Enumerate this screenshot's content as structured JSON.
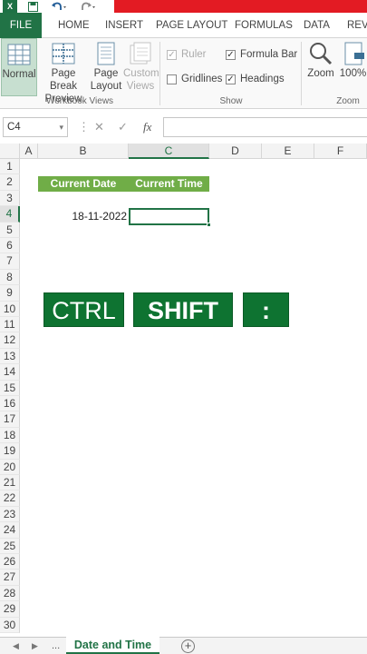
{
  "titlebar": {
    "app_icon": "excel-logo",
    "app_letter": "X",
    "quick_access": [
      "save-icon",
      "undo-icon",
      "redo-icon"
    ]
  },
  "ribbon_tabs": [
    "FILE",
    "HOME",
    "INSERT",
    "PAGE LAYOUT",
    "FORMULAS",
    "DATA",
    "REVI"
  ],
  "ribbon": {
    "workbook_views": {
      "group_label": "Workbook Views",
      "buttons": [
        {
          "label": "Normal",
          "label2": "",
          "active": true,
          "disabled": false,
          "icon": "normal-view-icon"
        },
        {
          "label": "Page Break",
          "label2": "Preview",
          "active": false,
          "disabled": false,
          "icon": "page-break-preview-icon"
        },
        {
          "label": "Page",
          "label2": "Layout",
          "active": false,
          "disabled": false,
          "icon": "page-layout-icon"
        },
        {
          "label": "Custom",
          "label2": "Views",
          "active": false,
          "disabled": true,
          "icon": "custom-views-icon"
        }
      ]
    },
    "show": {
      "group_label": "Show",
      "checkboxes": [
        {
          "label": "Ruler",
          "checked": true,
          "disabled": true
        },
        {
          "label": "Formula Bar",
          "checked": true,
          "disabled": false
        },
        {
          "label": "Gridlines",
          "checked": false,
          "disabled": false
        },
        {
          "label": "Headings",
          "checked": true,
          "disabled": false
        }
      ]
    },
    "zoom": {
      "group_label": "Zoom",
      "buttons": [
        {
          "label": "Zoom",
          "icon": "magnifier-icon"
        },
        {
          "label": "100%",
          "icon": "zoom-100-icon"
        }
      ]
    }
  },
  "formula_bar": {
    "name_box": "C4",
    "name_box_caret": "▾",
    "more": "⋮",
    "cancel": "✕",
    "enter": "✓",
    "fx": "fx",
    "formula": ""
  },
  "grid": {
    "columns": [
      "A",
      "B",
      "C",
      "D",
      "E",
      "F"
    ],
    "selected_column": "C",
    "rows": [
      "1",
      "2",
      "3",
      "4",
      "5",
      "6",
      "7",
      "8",
      "9",
      "10",
      "11",
      "12",
      "13",
      "14",
      "15",
      "16",
      "17",
      "18",
      "19",
      "20",
      "21",
      "22",
      "23",
      "24",
      "25",
      "26",
      "27",
      "28",
      "29",
      "30"
    ],
    "selected_row": "4",
    "header_b2": "Current Date",
    "header_c2": "Current Time",
    "b4_value": "18-11-2022",
    "c4_value": "",
    "header_fill": "#70ad47",
    "accent": "#217346"
  },
  "keys": [
    "CTRL",
    "SHIFT",
    ":"
  ],
  "key_fill": "#0e7331",
  "sheetbar": {
    "prev": "◀",
    "next": "▶",
    "ellipsis": "...",
    "active_sheet": "Date and Time",
    "add_sheet": "+"
  }
}
